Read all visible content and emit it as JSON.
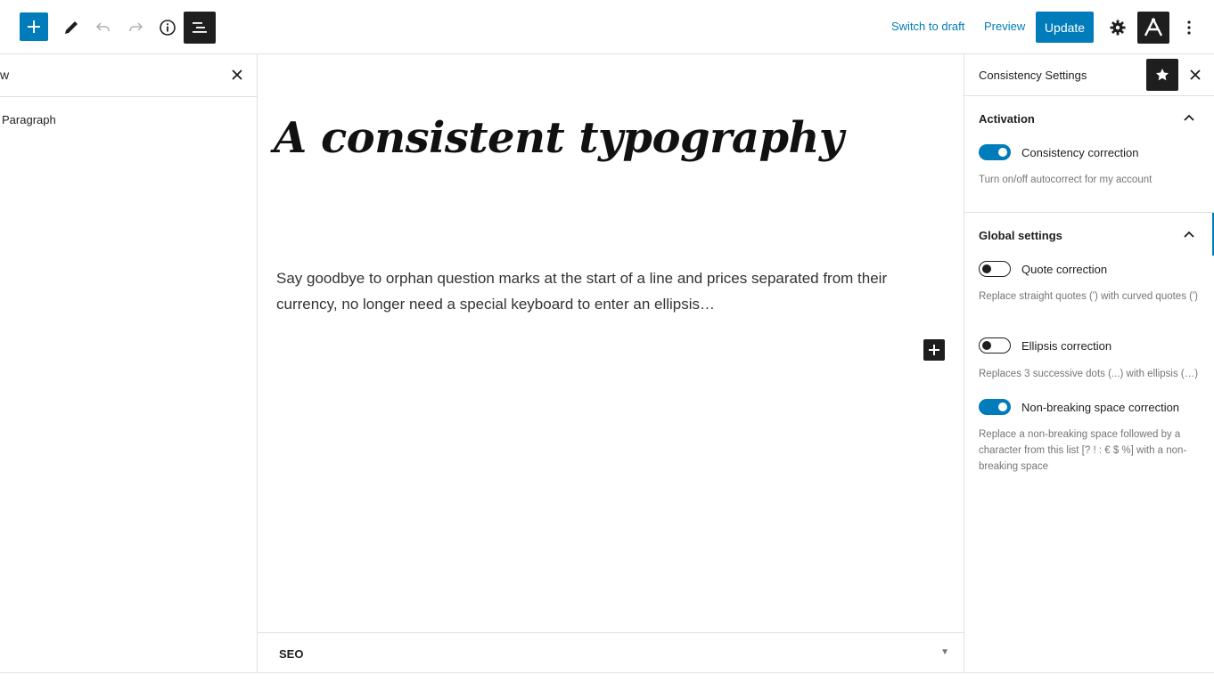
{
  "toolbar": {
    "add_block_icon": "plus-icon",
    "tools_icon": "pencil-icon",
    "undo_icon": "undo-icon",
    "redo_icon": "redo-icon",
    "details_icon": "info-icon",
    "list_view_icon": "list-view-icon",
    "switch_to_draft": "Switch to draft",
    "preview": "Preview",
    "update": "Update",
    "settings_icon": "gear-icon",
    "plugin_icon": "a-logo-icon",
    "options_icon": "more-vertical-icon"
  },
  "list_view": {
    "title": "w",
    "items": [
      {
        "label": "Paragraph"
      }
    ]
  },
  "post": {
    "title": "A consistent typography",
    "paragraph": "Say goodbye to orphan question marks at the start of a line and prices separated from their currency, no longer need a special keyboard to enter an ellipsis…"
  },
  "seo": {
    "label": "SEO"
  },
  "sidebar": {
    "title": "Consistency Settings",
    "panels": [
      {
        "title": "Activation",
        "settings": [
          {
            "label": "Consistency correction",
            "enabled": true,
            "help": "Turn on/off autocorrect for my account"
          }
        ]
      },
      {
        "title": "Global settings",
        "settings": [
          {
            "label": "Quote correction",
            "enabled": false,
            "help": "Replace straight quotes (') with curved quotes (')"
          },
          {
            "label": "Ellipsis correction",
            "enabled": false,
            "help": "Replaces 3 successive dots (...) with ellipsis (…)"
          },
          {
            "label": "Non-breaking space correction",
            "enabled": true,
            "help": "Replace a non-breaking space followed by a character from this list [? ! : € $ %] with a non-breaking space"
          }
        ]
      }
    ]
  },
  "colors": {
    "accent": "#007cba",
    "dark": "#1e1e1e",
    "muted": "#757575",
    "border": "#e0e0e0"
  }
}
